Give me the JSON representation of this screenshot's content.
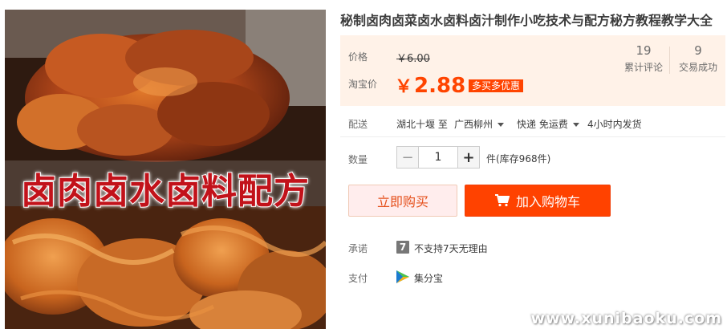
{
  "product": {
    "image_caption": "卤肉卤水卤料配方",
    "title": "秘制卤肉卤菜卤水卤料卤汁制作小吃技术与配方秘方教程教学大全"
  },
  "price": {
    "label": "价格",
    "original": "￥6.00",
    "taobao_label": "淘宝价",
    "currency": "￥",
    "value": "2.88",
    "promo": "多买多优惠"
  },
  "stats": [
    {
      "count": "19",
      "label": "累计评论"
    },
    {
      "count": "9",
      "label": "交易成功"
    }
  ],
  "shipping": {
    "label": "配送",
    "origin": "湖北十堰 至",
    "destination": "广西柳州",
    "method": "快递 免运费",
    "dispatch": "4小时内发货"
  },
  "quantity": {
    "label": "数量",
    "value": "1",
    "minus": "−",
    "plus": "+",
    "stock": "件(库存968件)"
  },
  "actions": {
    "buy_now": "立即购买",
    "add_to_cart": "加入购物车"
  },
  "promise": {
    "label": "承诺",
    "icon_text": "7",
    "text": "不支持7天无理由"
  },
  "payment": {
    "label": "支付",
    "method": "集分宝"
  },
  "watermark": "www.xunibaoku.com",
  "colors": {
    "accent": "#ff4400",
    "price_box_bg": "#fff2e8",
    "cart_button": "#ff4200"
  }
}
